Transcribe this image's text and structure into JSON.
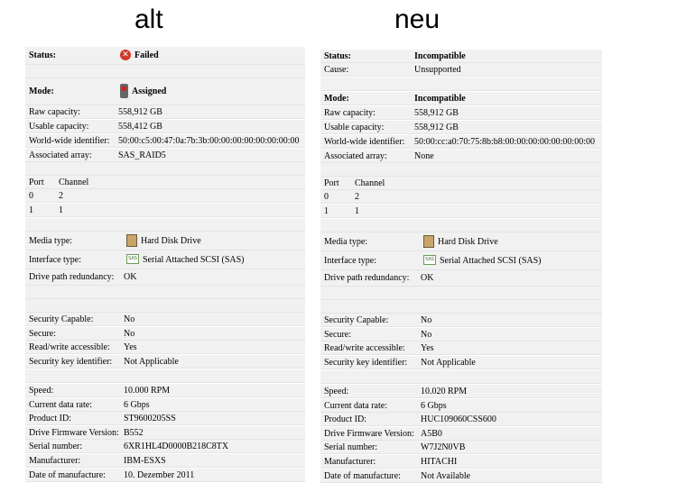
{
  "headings": {
    "left": "alt",
    "right": "neu"
  },
  "alt": {
    "status_label": "Status:",
    "status_value": "Failed",
    "mode_label": "Mode:",
    "mode_value": "Assigned",
    "raw_capacity_label": "Raw capacity:",
    "raw_capacity": "558,912 GB",
    "usable_capacity_label": "Usable capacity:",
    "usable_capacity": "558,412 GB",
    "wwid_label": "World-wide identifier:",
    "wwid": "50:00:c5:00:47:0a:7b:3b:00:00:00:00:00:00:00:00",
    "array_label": "Associated array:",
    "array": "SAS_RAID5",
    "port_header": "Port",
    "channel_header": "Channel",
    "ports": [
      {
        "port": "0",
        "channel": "2"
      },
      {
        "port": "1",
        "channel": "1"
      }
    ],
    "media_type_label": "Media type:",
    "media_type": "Hard Disk Drive",
    "interface_label": "Interface type:",
    "interface": "Serial Attached SCSI (SAS)",
    "redundancy_label": "Drive path redundancy:",
    "redundancy": "OK",
    "sec_capable_label": "Security Capable:",
    "sec_capable": "No",
    "secure_label": "Secure:",
    "secure": "No",
    "rw_label": "Read/write accessible:",
    "rw": "Yes",
    "sec_key_label": "Security key identifier:",
    "sec_key": "Not Applicable",
    "speed_label": "Speed:",
    "speed": "10.000 RPM",
    "data_rate_label": "Current data rate:",
    "data_rate": "6 Gbps",
    "product_label": "Product ID:",
    "product": "ST9600205SS",
    "firmware_label": "Drive Firmware Version:",
    "firmware": "B552",
    "serial_label": "Serial number:",
    "serial": "6XR1HL4D0000B218C8TX",
    "manufacturer_label": "Manufacturer:",
    "manufacturer": "IBM-ESXS",
    "date_label": "Date of manufacture:",
    "date": "10. Dezember 2011"
  },
  "neu": {
    "status_label": "Status:",
    "status_value": "Incompatible",
    "cause_label": "Cause:",
    "cause": "Unsupported",
    "mode_label": "Mode:",
    "mode_value": "Incompatible",
    "raw_capacity_label": "Raw capacity:",
    "raw_capacity": "558,912 GB",
    "usable_capacity_label": "Usable capacity:",
    "usable_capacity": "558,912 GB",
    "wwid_label": "World-wide identifier:",
    "wwid": "50:00:cc:a0:70:75:8b:b8:00:00:00:00:00:00:00:00",
    "array_label": "Associated array:",
    "array": "None",
    "port_header": "Port",
    "channel_header": "Channel",
    "ports": [
      {
        "port": "0",
        "channel": "2"
      },
      {
        "port": "1",
        "channel": "1"
      }
    ],
    "media_type_label": "Media type:",
    "media_type": "Hard Disk Drive",
    "interface_label": "Interface type:",
    "interface": "Serial Attached SCSI (SAS)",
    "redundancy_label": "Drive path redundancy:",
    "redundancy": "OK",
    "sec_capable_label": "Security Capable:",
    "sec_capable": "No",
    "secure_label": "Secure:",
    "secure": "No",
    "rw_label": "Read/write accessible:",
    "rw": "Yes",
    "sec_key_label": "Security key identifier:",
    "sec_key": "Not Applicable",
    "speed_label": "Speed:",
    "speed": "10.020 RPM",
    "data_rate_label": "Current data rate:",
    "data_rate": "6 Gbps",
    "product_label": "Product ID:",
    "product": "HUC109060CSS600",
    "firmware_label": "Drive Firmware Version:",
    "firmware": "A5B0",
    "serial_label": "Serial number:",
    "serial": "W7J2N0VB",
    "manufacturer_label": "Manufacturer:",
    "manufacturer": "HITACHI",
    "date_label": "Date of manufacture:",
    "date": "Not Available"
  }
}
